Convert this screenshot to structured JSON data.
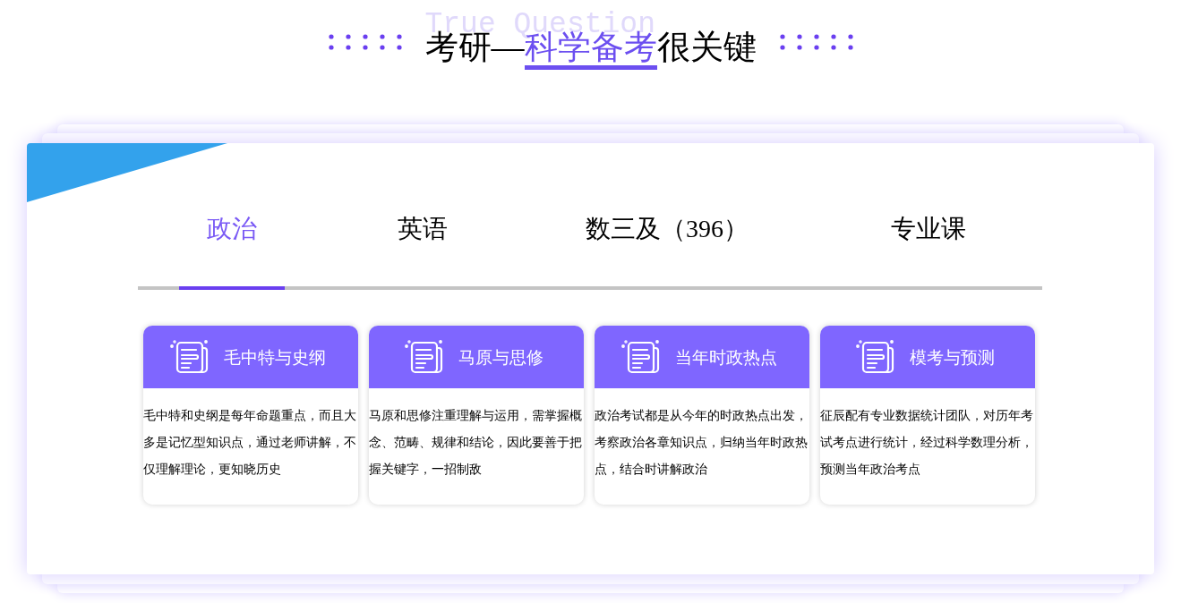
{
  "header": {
    "background_text": "True Question",
    "title": {
      "before": "考研—",
      "highlight": "科学备考",
      "after": "很关键"
    }
  },
  "tabs": [
    {
      "label": "政治",
      "selected": true
    },
    {
      "label": "英语",
      "selected": false
    },
    {
      "label": "数三及（396）",
      "selected": false
    },
    {
      "label": "专业课",
      "selected": false
    }
  ],
  "cards": [
    {
      "title": "毛中特与史纲",
      "text": "毛中特和史纲是每年命题重点，而且大多是记忆型知识点，通过老师讲解，不仅理解理论，更知晓历史"
    },
    {
      "title": "马原与思修",
      "text": "马原和思修注重理解与运用，需掌握概念、范畴、规律和结论，因此要善于把握关键字，一招制敌"
    },
    {
      "title": "当年时政热点",
      "text": "政治考试都是从今年的时政热点出发，考察政治各章知识点，归纳当年时政热点，结合时讲解政治"
    },
    {
      "title": "模考与预测",
      "text": "征辰配有专业数据统计团队，对历年考试考点进行统计，经过科学数理分析，预测当年政治考点"
    }
  ]
}
